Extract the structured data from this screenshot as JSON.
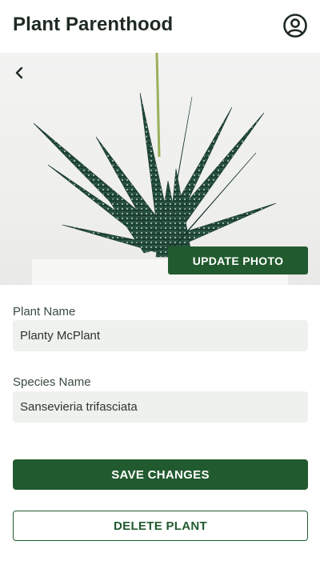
{
  "header": {
    "title": "Plant Parenthood",
    "profile_icon": "user-circle-icon"
  },
  "photo": {
    "back_icon": "chevron-left-icon",
    "update_label": "UPDATE PHOTO"
  },
  "form": {
    "plant_name": {
      "label": "Plant Name",
      "value": "Planty McPlant"
    },
    "species_name": {
      "label": "Species Name",
      "value": "Sansevieria trifasciata"
    }
  },
  "actions": {
    "save_label": "SAVE CHANGES",
    "delete_label": "DELETE PLANT"
  },
  "colors": {
    "primary": "#225a2f",
    "input_bg": "#eff1ef",
    "text": "#1f2a22"
  }
}
